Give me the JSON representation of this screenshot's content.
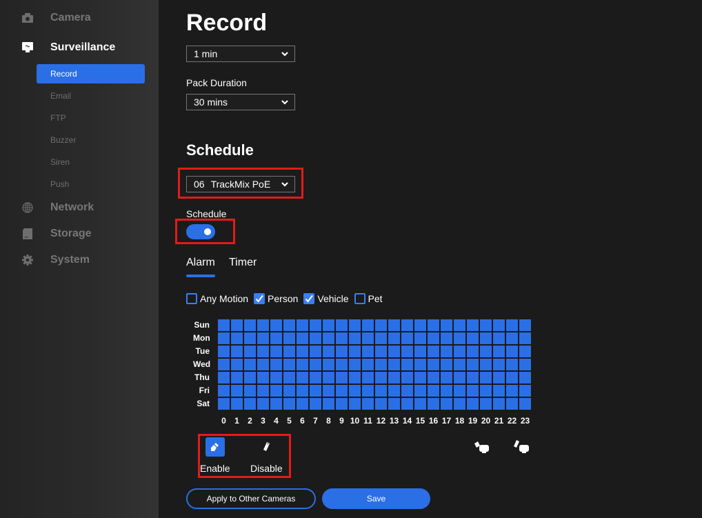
{
  "colors": {
    "accent": "#2a6fe6",
    "highlight_box": "#e31b1b",
    "background": "#1b1b1b",
    "sidebar_text_inactive": "#777777"
  },
  "sidebar": {
    "items": [
      {
        "label": "Camera",
        "icon": "camera-icon",
        "active": false
      },
      {
        "label": "Surveillance",
        "icon": "monitor-icon",
        "active": true
      },
      {
        "label": "Network",
        "icon": "globe-icon",
        "active": false
      },
      {
        "label": "Storage",
        "icon": "storage-icon",
        "active": false
      },
      {
        "label": "System",
        "icon": "gear-icon",
        "active": false
      }
    ],
    "sub_items": [
      {
        "label": "Record",
        "active": true
      },
      {
        "label": "Email",
        "active": false
      },
      {
        "label": "FTP",
        "active": false
      },
      {
        "label": "Buzzer",
        "active": false
      },
      {
        "label": "Siren",
        "active": false
      },
      {
        "label": "Push",
        "active": false
      }
    ]
  },
  "main": {
    "title": "Record",
    "post_record_select": {
      "value": "1 min"
    },
    "pack_duration": {
      "label": "Pack Duration",
      "value": "30 mins"
    },
    "schedule_heading": "Schedule",
    "camera_select": {
      "number": "06",
      "name": "TrackMix PoE"
    },
    "schedule_toggle": {
      "label": "Schedule",
      "enabled": true
    },
    "tabs": [
      {
        "label": "Alarm",
        "active": true
      },
      {
        "label": "Timer",
        "active": false
      }
    ],
    "detection_types": [
      {
        "label": "Any Motion",
        "checked": false
      },
      {
        "label": "Person",
        "checked": true
      },
      {
        "label": "Vehicle",
        "checked": true
      },
      {
        "label": "Pet",
        "checked": false
      }
    ],
    "grid": {
      "days": [
        "Sun",
        "Mon",
        "Tue",
        "Wed",
        "Thu",
        "Fri",
        "Sat"
      ],
      "hours": [
        "0",
        "1",
        "2",
        "3",
        "4",
        "5",
        "6",
        "7",
        "8",
        "9",
        "10",
        "11",
        "12",
        "13",
        "14",
        "15",
        "16",
        "17",
        "18",
        "19",
        "20",
        "21",
        "22",
        "23"
      ],
      "all_enabled": true
    },
    "tools": {
      "enable_label": "Enable",
      "disable_label": "Disable",
      "enable_all_icon": "brush-all-icon",
      "disable_all_icon": "eraser-all-icon"
    },
    "buttons": {
      "apply_label": "Apply to Other Cameras",
      "save_label": "Save"
    }
  }
}
